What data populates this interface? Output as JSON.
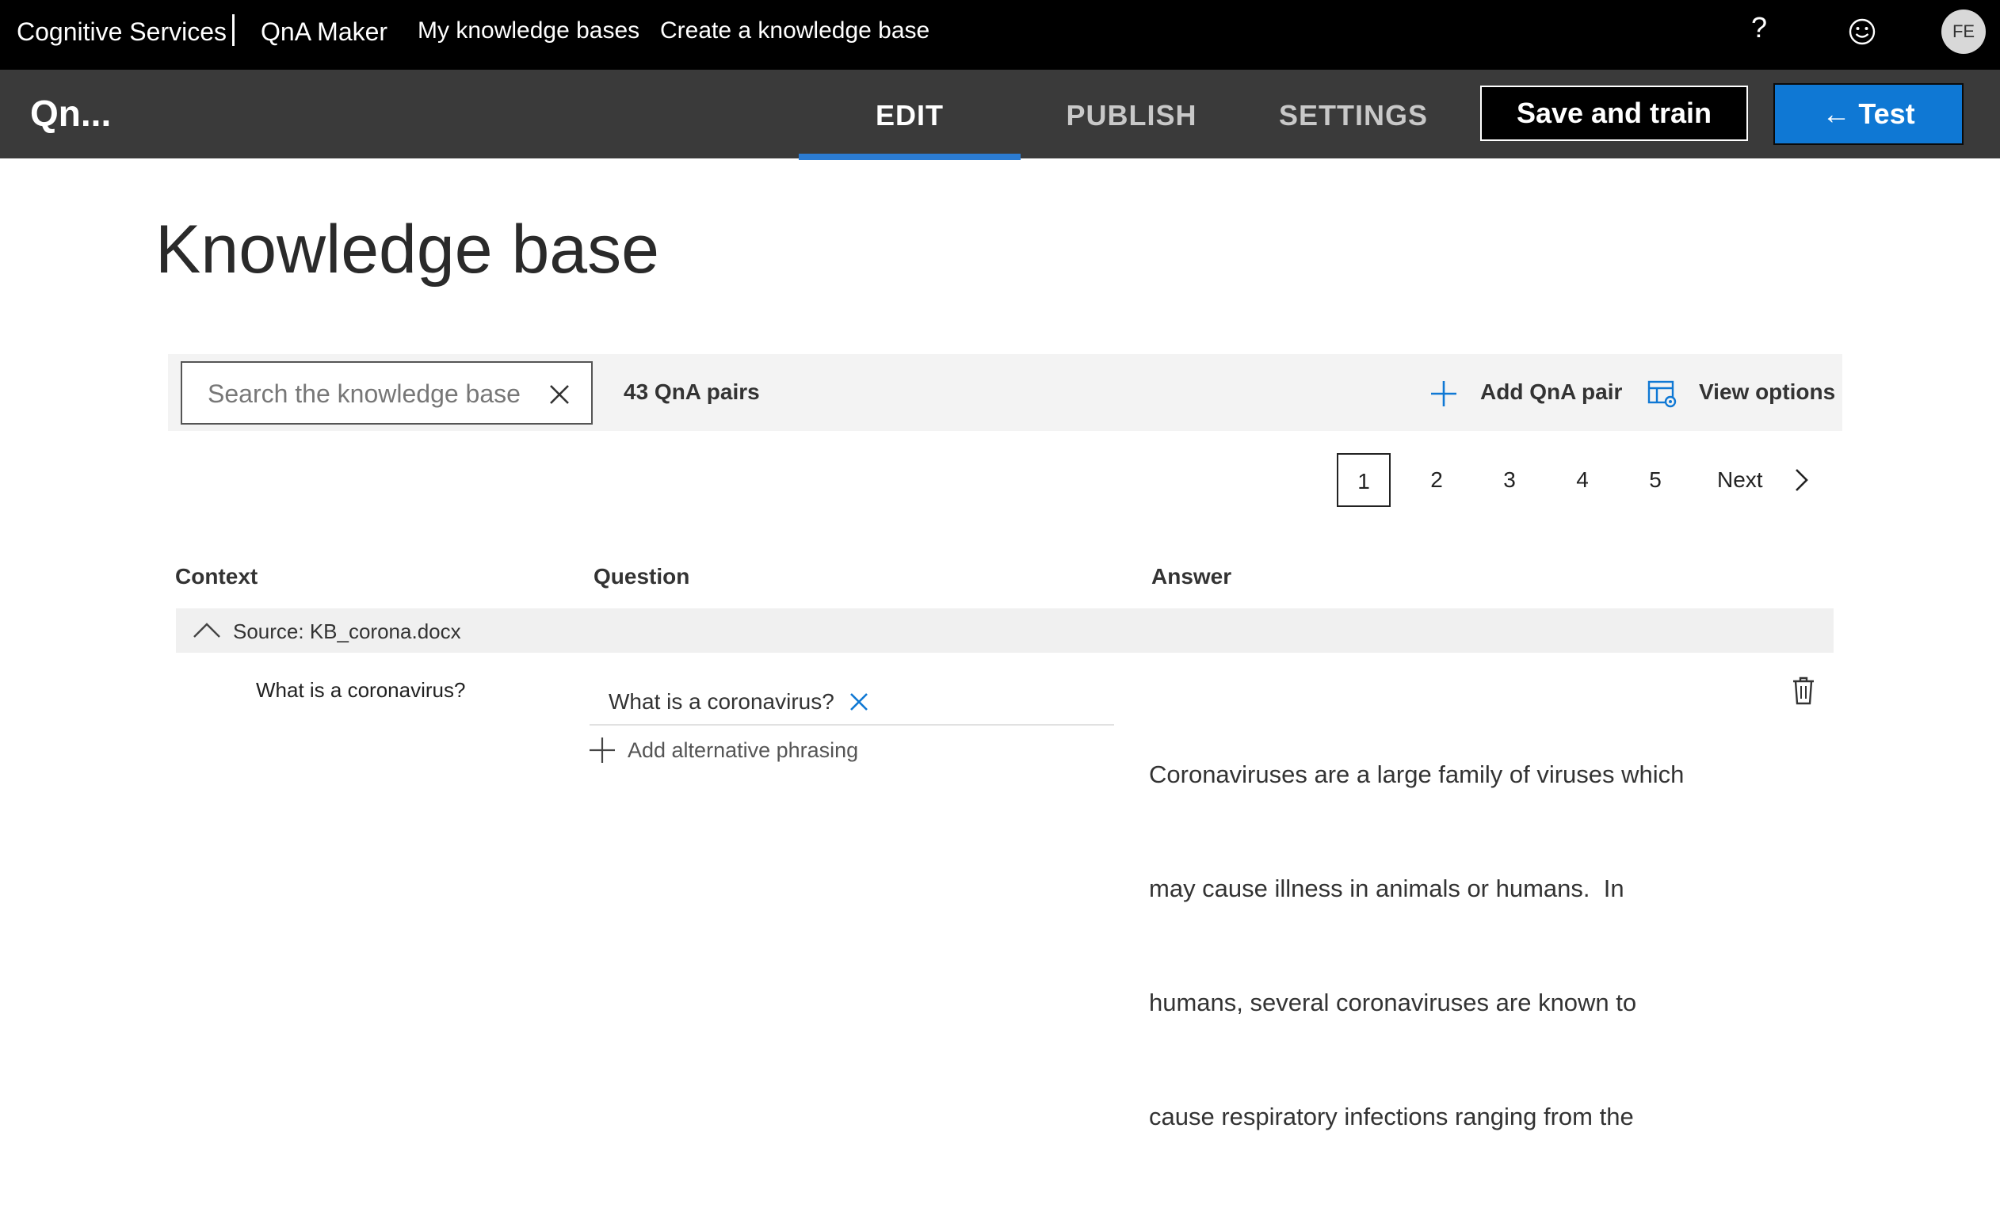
{
  "topbar": {
    "brand": "Cognitive Services",
    "product": "QnA Maker",
    "nav": [
      "My knowledge bases",
      "Create a knowledge base"
    ],
    "help": "?",
    "avatar_initials": "FE"
  },
  "command_bar": {
    "kb_name": "Qn...",
    "tabs": [
      "EDIT",
      "PUBLISH",
      "SETTINGS"
    ],
    "active_tab": "EDIT",
    "save_label": "Save and train",
    "test_label": "← Test"
  },
  "page": {
    "title": "Knowledge base"
  },
  "toolbar": {
    "search_placeholder": "Search the knowledge base",
    "pair_count": "43 QnA pairs",
    "add_pair_label": "Add QnA pair",
    "view_options_label": "View options"
  },
  "pagination": {
    "pages": [
      "1",
      "2",
      "3",
      "4",
      "5"
    ],
    "current": "1",
    "next_label": "Next"
  },
  "table": {
    "headers": {
      "context": "Context",
      "question": "Question",
      "answer": "Answer"
    },
    "source_label": "Source: KB_corona.docx",
    "row": {
      "context": "What is a coronavirus?",
      "question": "What is a coronavirus?",
      "add_alt_label": "Add alternative phrasing",
      "answer_lines": [
        "Coronaviruses are a large family of viruses which",
        "may cause illness in animals or humans.  In",
        "humans, several coronaviruses are known to",
        "cause respiratory infections ranging from the"
      ]
    }
  },
  "colors": {
    "accent": "#0f78d4",
    "tab_underline": "#2b7cd3",
    "topbar": "#000000",
    "cmdbar": "#3a3a3a"
  }
}
